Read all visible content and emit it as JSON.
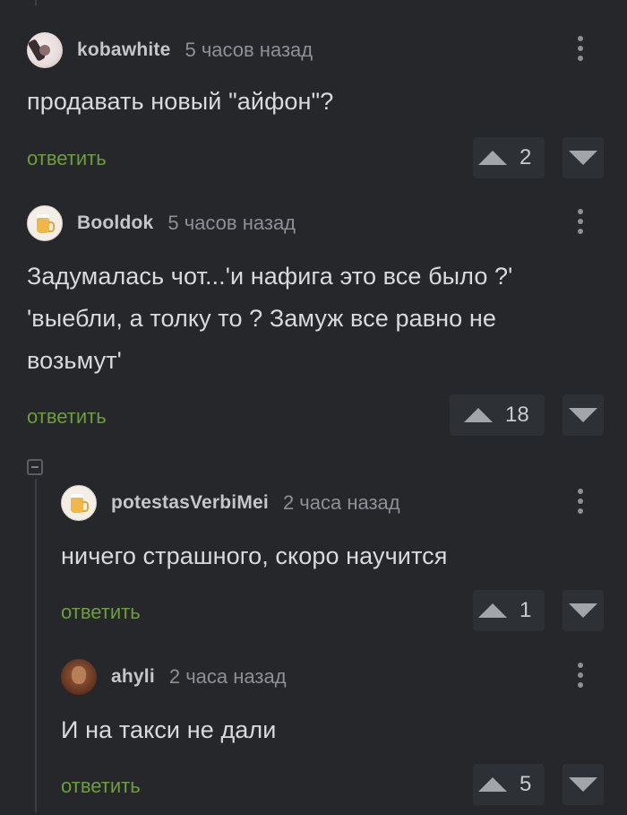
{
  "comments": [
    {
      "username": "kobawhite",
      "time": "5 часов назад",
      "text": "продавать новый \"айфон\"?",
      "reply_label": "ответить",
      "rating": "2",
      "avatar": "avatar-photo"
    },
    {
      "username": "Booldok",
      "time": "5 часов назад",
      "text": "Задумалась чот...'и нафига это все было ?' 'выебли, а толку то ? Замуж все равно не возьмут'",
      "reply_label": "ответить",
      "rating": "18",
      "avatar": "beer-avatar"
    },
    {
      "username": "potestasVerbiMei",
      "time": "2 часа назад",
      "text": "ничего страшного, скоро научится",
      "reply_label": "ответить",
      "rating": "1",
      "avatar": "beer-avatar"
    },
    {
      "username": "ahyli",
      "time": "2 часа назад",
      "text": "И на такси не дали",
      "reply_label": "ответить",
      "rating": "5",
      "avatar": "avatar-photo"
    }
  ],
  "icons": {
    "upvote": "triangle-up-icon",
    "downvote": "triangle-down-icon",
    "more": "vertical-dots-icon",
    "collapse": "minus-square-icon"
  },
  "colors": {
    "background": "#25272b",
    "reply_link": "#6d9e3b",
    "text": "#d9dadc",
    "muted": "#8d9095"
  }
}
